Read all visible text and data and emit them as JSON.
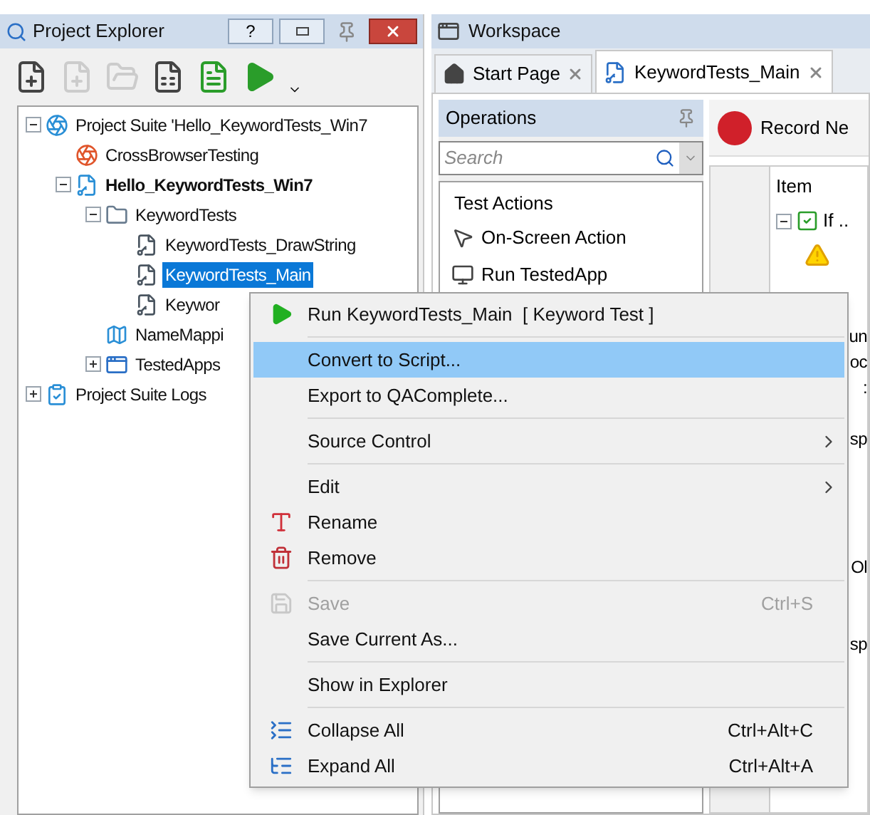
{
  "explorer": {
    "title": "Project Explorer",
    "help_button": "?",
    "tree": [
      {
        "label": "Project Suite 'Hello_KeywordTests_Win7",
        "kind": "suite",
        "expanded": true,
        "bold": false,
        "selected": false,
        "children": [
          {
            "label": "CrossBrowserTesting",
            "kind": "cbt",
            "bold": false,
            "selected": false
          },
          {
            "label": "Hello_KeywordTests_Win7",
            "kind": "project",
            "expanded": true,
            "bold": true,
            "selected": false,
            "children": [
              {
                "label": "KeywordTests",
                "kind": "folder",
                "expanded": true,
                "bold": false,
                "selected": false,
                "children": [
                  {
                    "label": "KeywordTests_DrawString",
                    "kind": "keyword-test",
                    "bold": false,
                    "selected": false
                  },
                  {
                    "label": "KeywordTests_Main",
                    "kind": "keyword-test",
                    "bold": false,
                    "selected": true
                  },
                  {
                    "label": "Keywor",
                    "kind": "keyword-test",
                    "bold": false,
                    "selected": false
                  }
                ]
              },
              {
                "label": "NameMappi",
                "kind": "namemapping",
                "bold": false,
                "selected": false
              },
              {
                "label": "TestedApps",
                "kind": "testedapps",
                "expanded": false,
                "bold": false,
                "selected": false
              }
            ]
          }
        ]
      },
      {
        "label": "Project Suite Logs",
        "kind": "logs",
        "expanded": false,
        "bold": false,
        "selected": false
      }
    ]
  },
  "workspace": {
    "title": "Workspace",
    "tabs": [
      {
        "label": "Start Page",
        "kind": "home",
        "selected": false
      },
      {
        "label": "KeywordTests_Main",
        "kind": "keyword-test",
        "selected": true
      }
    ],
    "operations": {
      "title": "Operations",
      "search": {
        "placeholder": "Search"
      },
      "group": "Test Actions",
      "items": [
        {
          "label": "On-Screen Action",
          "kind": "onscreen"
        },
        {
          "label": "Run TestedApp",
          "kind": "run-app"
        }
      ]
    },
    "editor": {
      "record_button": "Record Ne",
      "column": "Item",
      "first_row": "If ..",
      "rows": [
        "",
        "",
        "un",
        "oc",
        ":",
        "",
        "sp",
        "",
        "",
        "",
        "",
        "Ol",
        "",
        "",
        "sp"
      ]
    }
  },
  "context_menu": [
    {
      "kind": "run",
      "label": "Run KeywordTests_Main  [ Keyword Test ]",
      "disabled": false,
      "selected": false,
      "submenu": false
    },
    {
      "kind": "separator"
    },
    {
      "kind": "item",
      "label": "Convert to Script...",
      "disabled": false,
      "selected": true,
      "submenu": false
    },
    {
      "kind": "item",
      "label": "Export to QAComplete...",
      "disabled": false,
      "selected": false,
      "submenu": false
    },
    {
      "kind": "separator"
    },
    {
      "kind": "item",
      "label": "Source Control",
      "disabled": false,
      "selected": false,
      "submenu": true
    },
    {
      "kind": "separator"
    },
    {
      "kind": "item",
      "label": "Edit",
      "disabled": false,
      "selected": false,
      "submenu": true
    },
    {
      "kind": "rename",
      "label": "Rename",
      "disabled": false,
      "selected": false,
      "submenu": false
    },
    {
      "kind": "remove",
      "label": "Remove",
      "disabled": false,
      "selected": false,
      "submenu": false
    },
    {
      "kind": "separator"
    },
    {
      "kind": "save",
      "label": "Save",
      "shortcut": "Ctrl+S",
      "disabled": true,
      "selected": false,
      "submenu": false
    },
    {
      "kind": "item",
      "label": "Save Current As...",
      "disabled": false,
      "selected": false,
      "submenu": false
    },
    {
      "kind": "separator"
    },
    {
      "kind": "item",
      "label": "Show in Explorer",
      "disabled": false,
      "selected": false,
      "submenu": false
    },
    {
      "kind": "separator"
    },
    {
      "kind": "collapse",
      "label": "Collapse All",
      "shortcut": "Ctrl+Alt+C",
      "disabled": false,
      "selected": false,
      "submenu": false
    },
    {
      "kind": "expand",
      "label": "Expand All",
      "shortcut": "Ctrl+Alt+A",
      "disabled": false,
      "selected": false,
      "submenu": false
    }
  ]
}
